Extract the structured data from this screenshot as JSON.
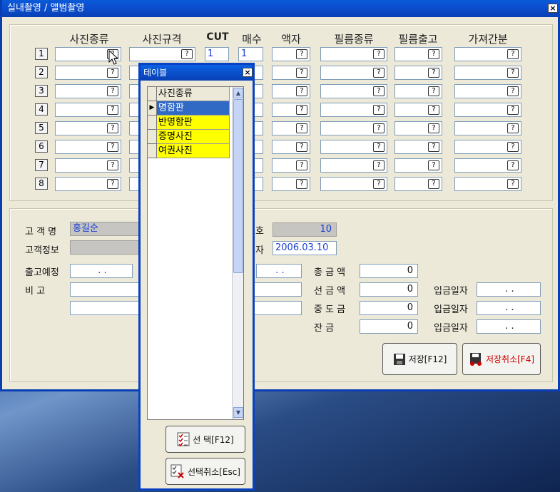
{
  "window": {
    "title": "실내촬영 / 앨범촬영",
    "close": "×"
  },
  "columns": [
    "사진종류",
    "사진규격",
    "CUT",
    "매수",
    "액자",
    "필름종류",
    "필름출고",
    "가져간분"
  ],
  "rows": [
    {
      "num": "1",
      "cut": "1",
      "qty": "1"
    },
    {
      "num": "2",
      "cut": "",
      "qty": ""
    },
    {
      "num": "3",
      "cut": "",
      "qty": ""
    },
    {
      "num": "4",
      "cut": "",
      "qty": ""
    },
    {
      "num": "5",
      "cut": "",
      "qty": ""
    },
    {
      "num": "6",
      "cut": "",
      "qty": ""
    },
    {
      "num": "7",
      "cut": "",
      "qty": ""
    },
    {
      "num": "8",
      "cut": "",
      "qty": ""
    }
  ],
  "lookup_button": "?",
  "customer": {
    "name_label": "고 객 명",
    "name_value": "홍길순",
    "info_label": "고객정보",
    "info_value": "",
    "number_label": "호",
    "number_value": "10",
    "date_label": "자",
    "date_value": "2006.03.10",
    "due_label": "출고예정",
    "due_value": " .  .",
    "due2_value": " .  .",
    "remark_label": "비    고",
    "remark_value": "",
    "remark2_value": ""
  },
  "money": {
    "total_label": "총 금 액",
    "total_value": "0",
    "advance_label": "선 금 액",
    "advance_value": "0",
    "middle_label": "중 도 금",
    "middle_value": "0",
    "balance_label": "잔    금",
    "balance_value": "0",
    "paydate_label": "입금일자",
    "paydate_value": " .  ."
  },
  "buttons": {
    "save": "저장[F12]",
    "cancel_save": "저장취소[F4]"
  },
  "dialog": {
    "title": "테이블",
    "close": "×",
    "header": "사진종류",
    "items": [
      "명함판",
      "반명함판",
      "증명사진",
      "여권사진"
    ],
    "select_button": "선 택[F12]",
    "cancel_button": "선택취소[Esc]"
  },
  "colors": {
    "title_bar": "#0b4fd0",
    "selected_row": "#316ac5",
    "item_highlight": "#ffff00",
    "value_text": "#1a3fd6",
    "cancel_text": "#cc0000"
  }
}
